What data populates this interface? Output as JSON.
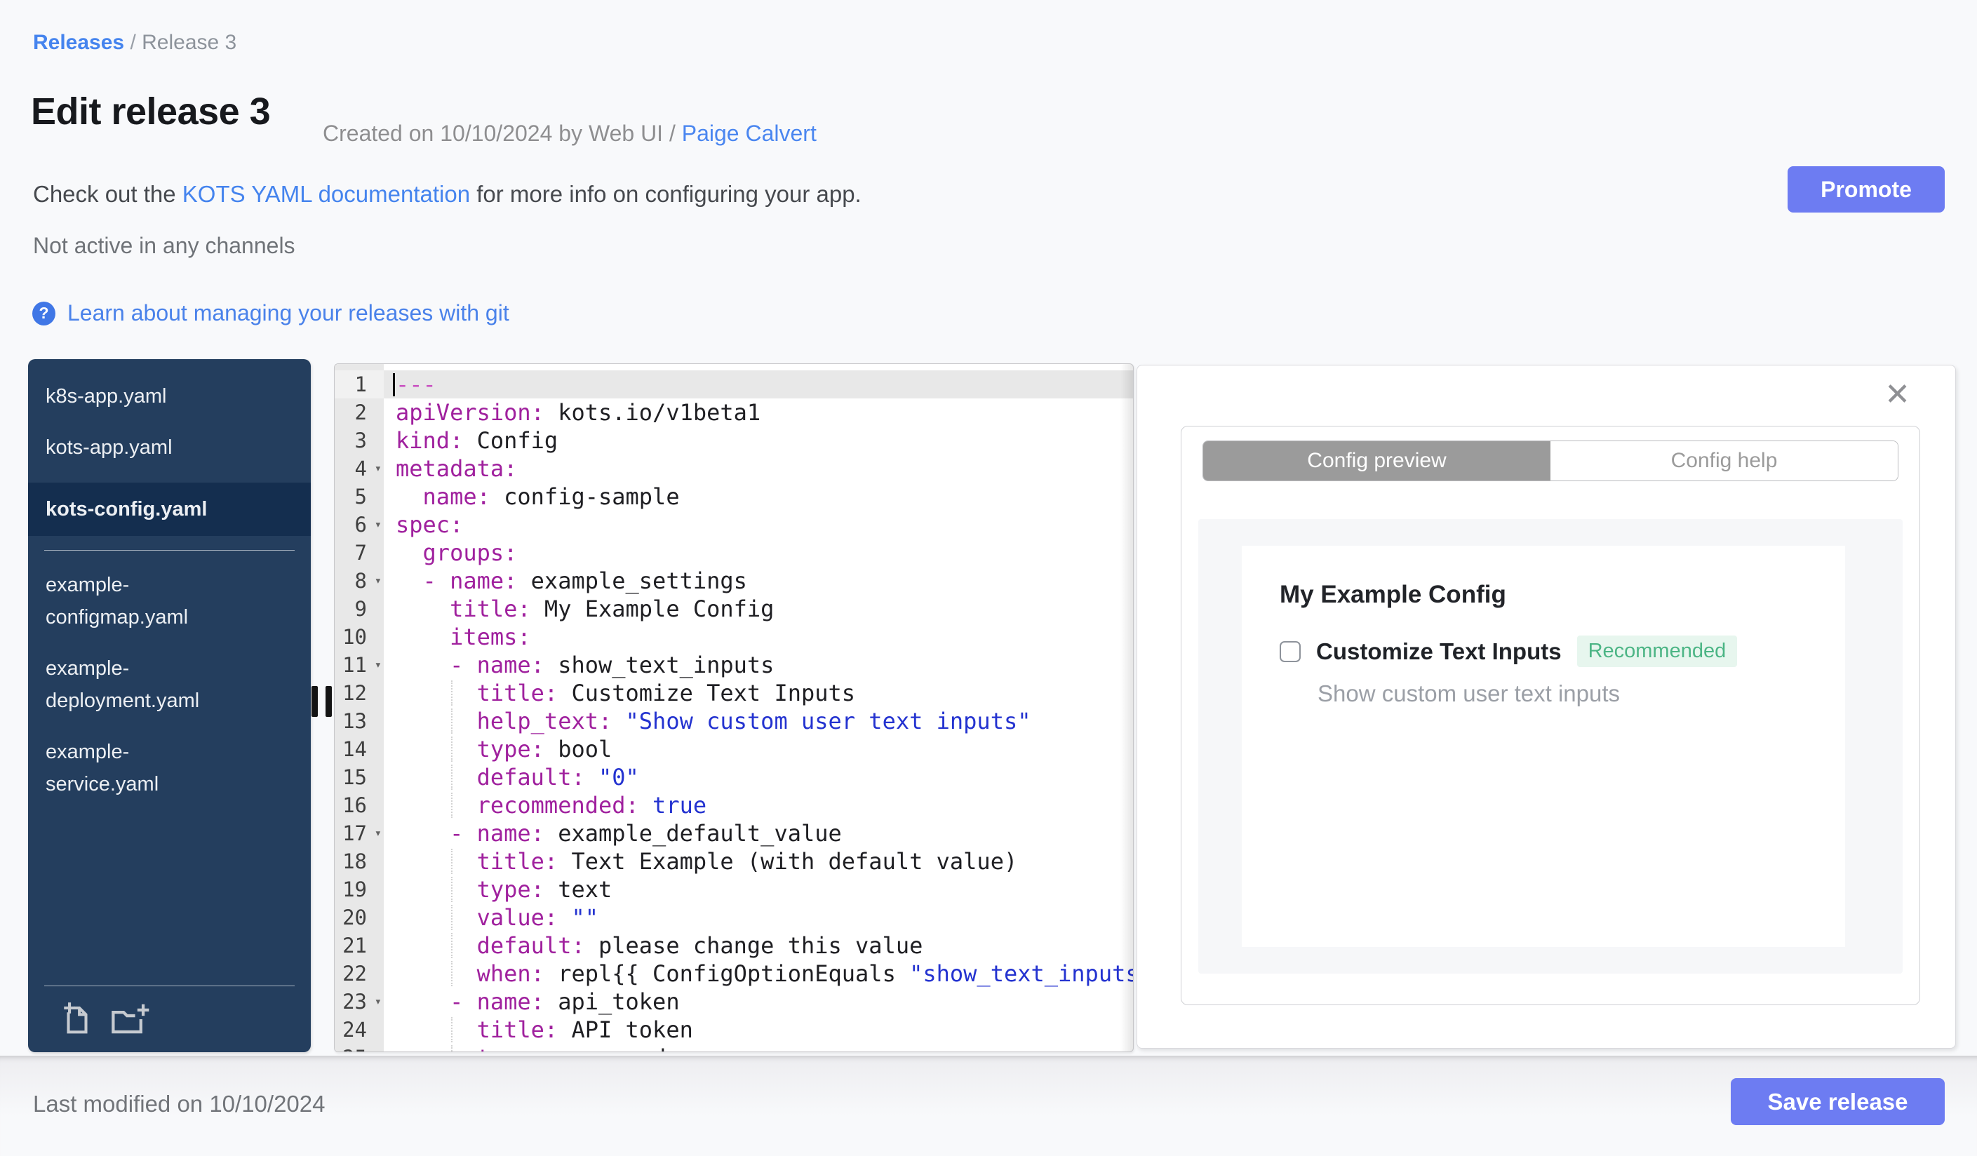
{
  "colors": {
    "accent_button": "#6d7cf2",
    "link_blue": "#4584ee",
    "sidebar_bg": "#243e5e",
    "sidebar_selected_bg": "#142e4f",
    "badge_green": "#4cb585",
    "badge_green_bg": "#e7f6ee",
    "active_tab_gray": "#9b9b9b",
    "code_key": "#a0219e",
    "code_string": "#2433d0"
  },
  "header": {
    "breadcrumb": {
      "root": "Releases",
      "separator": " / ",
      "current": "Release 3"
    },
    "title": "Edit release 3",
    "created_prefix": "Created on 10/10/2024 by Web UI / ",
    "created_author": "Paige Calvert",
    "docs_before": "Check out the ",
    "docs_link": "KOTS YAML documentation",
    "docs_after": " for more info on configuring your app.",
    "promote_label": "Promote",
    "channel_status": "Not active in any channels",
    "git_help_icon": "?",
    "git_help_link": "Learn about managing your releases with git"
  },
  "sidebar": {
    "files": [
      {
        "name": "k8s-app.yaml",
        "selected": false
      },
      {
        "name": "kots-app.yaml",
        "selected": false
      },
      {
        "name": "kots-config.yaml",
        "selected": true
      }
    ],
    "files_secondary": [
      {
        "name": "example-configmap.yaml"
      },
      {
        "name": "example-deployment.yaml"
      },
      {
        "name": "example-service.yaml"
      }
    ],
    "actions": [
      {
        "icon": "new-file-icon"
      },
      {
        "icon": "new-folder-icon"
      }
    ]
  },
  "editor": {
    "lines": [
      {
        "n": 1,
        "active": true,
        "cursor": true,
        "parts": [
          [
            "---",
            "doc"
          ]
        ]
      },
      {
        "n": 2,
        "parts": [
          [
            "apiVersion:",
            "key"
          ],
          [
            " kots.io/v1beta1",
            "val"
          ]
        ]
      },
      {
        "n": 3,
        "parts": [
          [
            "kind:",
            "key"
          ],
          [
            " Config",
            "val"
          ]
        ]
      },
      {
        "n": 4,
        "fold": true,
        "parts": [
          [
            "metadata:",
            "key"
          ]
        ]
      },
      {
        "n": 5,
        "parts": [
          [
            "  name:",
            "key"
          ],
          [
            " config-sample",
            "val"
          ]
        ]
      },
      {
        "n": 6,
        "fold": true,
        "parts": [
          [
            "spec:",
            "key"
          ]
        ]
      },
      {
        "n": 7,
        "parts": [
          [
            "  groups:",
            "key"
          ]
        ]
      },
      {
        "n": 8,
        "fold": true,
        "parts": [
          [
            "  - name:",
            "key"
          ],
          [
            " example_settings",
            "val"
          ]
        ]
      },
      {
        "n": 9,
        "parts": [
          [
            "    title:",
            "key"
          ],
          [
            " My Example Config",
            "val"
          ]
        ]
      },
      {
        "n": 10,
        "parts": [
          [
            "    items:",
            "key"
          ]
        ]
      },
      {
        "n": 11,
        "fold": true,
        "parts": [
          [
            "    - name:",
            "key"
          ],
          [
            " show_text_inputs",
            "val"
          ]
        ]
      },
      {
        "n": 12,
        "guide": true,
        "parts": [
          [
            "      title:",
            "key"
          ],
          [
            " Customize Text Inputs",
            "val"
          ]
        ]
      },
      {
        "n": 13,
        "guide": true,
        "parts": [
          [
            "      help_text:",
            "key"
          ],
          [
            " ",
            "val"
          ],
          [
            "\"Show custom user text inputs\"",
            "str"
          ]
        ]
      },
      {
        "n": 14,
        "guide": true,
        "parts": [
          [
            "      type:",
            "key"
          ],
          [
            " bool",
            "val"
          ]
        ]
      },
      {
        "n": 15,
        "guide": true,
        "parts": [
          [
            "      default:",
            "key"
          ],
          [
            " ",
            "val"
          ],
          [
            "\"0\"",
            "str"
          ]
        ]
      },
      {
        "n": 16,
        "guide": true,
        "parts": [
          [
            "      recommended:",
            "key"
          ],
          [
            " ",
            "val"
          ],
          [
            "true",
            "bool"
          ]
        ]
      },
      {
        "n": 17,
        "fold": true,
        "parts": [
          [
            "    - name:",
            "key"
          ],
          [
            " example_default_value",
            "val"
          ]
        ]
      },
      {
        "n": 18,
        "guide": true,
        "parts": [
          [
            "      title:",
            "key"
          ],
          [
            " Text Example (with default value)",
            "val"
          ]
        ]
      },
      {
        "n": 19,
        "guide": true,
        "parts": [
          [
            "      type:",
            "key"
          ],
          [
            " text",
            "val"
          ]
        ]
      },
      {
        "n": 20,
        "guide": true,
        "parts": [
          [
            "      value:",
            "key"
          ],
          [
            " ",
            "val"
          ],
          [
            "\"\"",
            "str"
          ]
        ]
      },
      {
        "n": 21,
        "guide": true,
        "parts": [
          [
            "      default:",
            "key"
          ],
          [
            " please change this value",
            "val"
          ]
        ]
      },
      {
        "n": 22,
        "guide": true,
        "parts": [
          [
            "      when:",
            "key"
          ],
          [
            " repl{{ ConfigOptionEquals ",
            "val"
          ],
          [
            "\"show_text_inputs\"",
            "str"
          ]
        ]
      },
      {
        "n": 23,
        "fold": true,
        "parts": [
          [
            "    - name:",
            "key"
          ],
          [
            " api_token",
            "val"
          ]
        ]
      },
      {
        "n": 24,
        "guide": true,
        "parts": [
          [
            "      title:",
            "key"
          ],
          [
            " API token",
            "val"
          ]
        ]
      },
      {
        "n": 25,
        "guide": true,
        "parts": [
          [
            "      type:",
            "key"
          ],
          [
            " password",
            "val"
          ]
        ]
      }
    ]
  },
  "preview": {
    "close_icon": "✕",
    "tabs": [
      {
        "label": "Config preview",
        "active": true
      },
      {
        "label": "Config help",
        "active": false
      }
    ],
    "group_title": "My Example Config",
    "item": {
      "checked": false,
      "label": "Customize Text Inputs",
      "badge": "Recommended",
      "help_text": "Show custom user text inputs"
    }
  },
  "footer": {
    "last_modified": "Last modified on 10/10/2024",
    "save_label": "Save release"
  }
}
